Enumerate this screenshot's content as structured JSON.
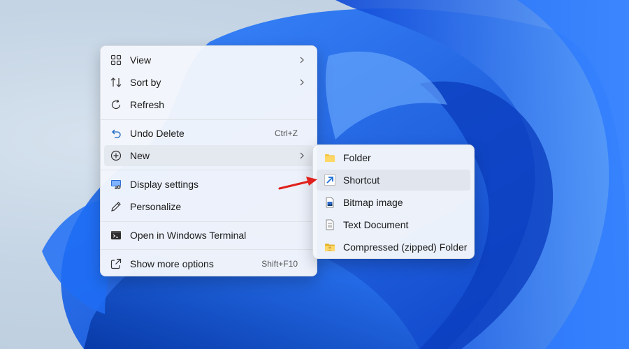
{
  "context_menu": {
    "items": [
      {
        "label": "View",
        "icon": "grid-icon"
      },
      {
        "label": "Sort by",
        "icon": "sort-icon"
      },
      {
        "label": "Refresh",
        "icon": "refresh-icon"
      },
      {
        "label": "Undo Delete",
        "icon": "undo-icon",
        "shortcut": "Ctrl+Z"
      },
      {
        "label": "New",
        "icon": "plus-circle-icon"
      },
      {
        "label": "Display settings",
        "icon": "display-icon"
      },
      {
        "label": "Personalize",
        "icon": "pen-icon"
      },
      {
        "label": "Open in Windows Terminal",
        "icon": "terminal-icon"
      },
      {
        "label": "Show more options",
        "icon": "share-icon",
        "shortcut": "Shift+F10"
      }
    ]
  },
  "new_submenu": {
    "items": [
      {
        "label": "Folder",
        "icon": "folder-icon"
      },
      {
        "label": "Shortcut",
        "icon": "shortcut-icon"
      },
      {
        "label": "Bitmap image",
        "icon": "bitmap-icon"
      },
      {
        "label": "Text Document",
        "icon": "text-document-icon"
      },
      {
        "label": "Compressed (zipped) Folder",
        "icon": "zip-folder-icon"
      }
    ]
  },
  "colors": {
    "wallpaper_blue": "#1463f0",
    "highlight": "#e4e8ef",
    "annotation_arrow": "#e0201c",
    "folder_yellow": "#f4c542"
  }
}
